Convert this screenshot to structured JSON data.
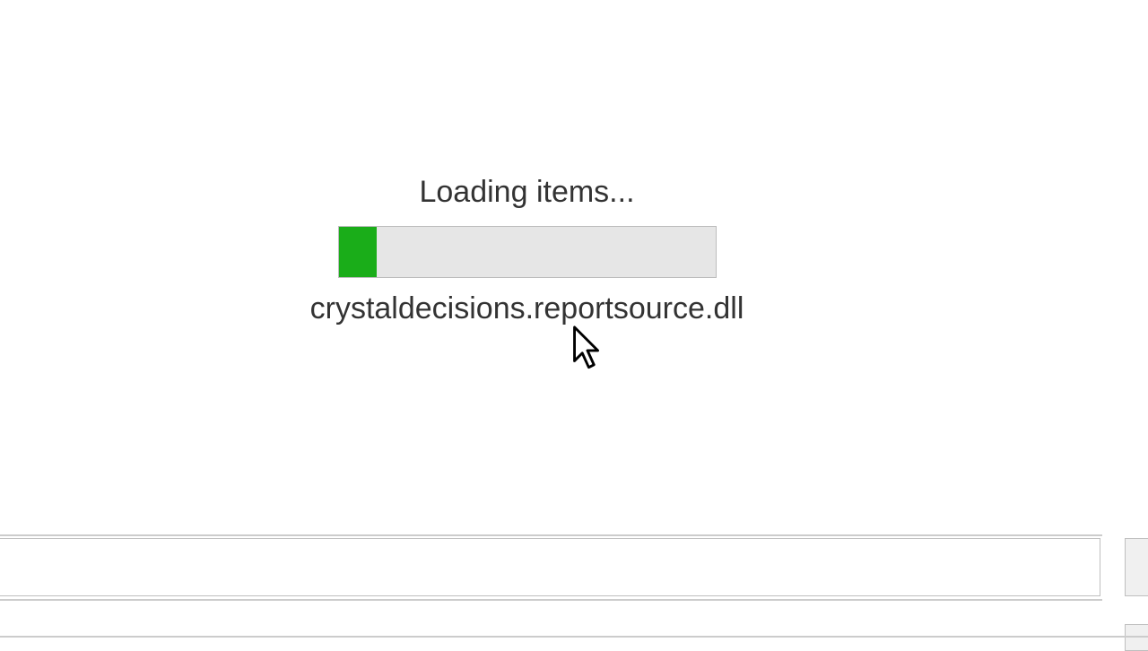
{
  "loading": {
    "title": "Loading items...",
    "filename": "crystaldecisions.reportsource.dll",
    "progress_percent": 10
  },
  "colors": {
    "progress_fill": "#1aad19",
    "progress_track": "#e6e6e6",
    "progress_border": "#bcbcbc"
  }
}
